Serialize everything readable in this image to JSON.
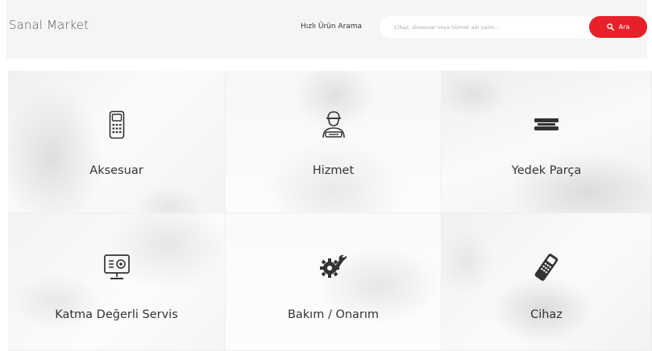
{
  "header": {
    "brand": "Sanal Market",
    "search_label": "Hızlı Ürün Arama",
    "search_placeholder": "Cihaz, aksesuar veya hizmet adı yazın...",
    "search_button_label": "Ara",
    "accent_color": "#e8202a"
  },
  "categories": [
    {
      "label": "Aksesuar",
      "icon": "pos-terminal-icon"
    },
    {
      "label": "Hizmet",
      "icon": "technician-icon"
    },
    {
      "label": "Yedek Parça",
      "icon": "spare-parts-icon"
    },
    {
      "label": "Katma Değerli Servis",
      "icon": "monitor-service-icon"
    },
    {
      "label": "Bakım / Onarım",
      "icon": "gear-wrench-icon"
    },
    {
      "label": "Cihaz",
      "icon": "card-reader-icon"
    }
  ]
}
